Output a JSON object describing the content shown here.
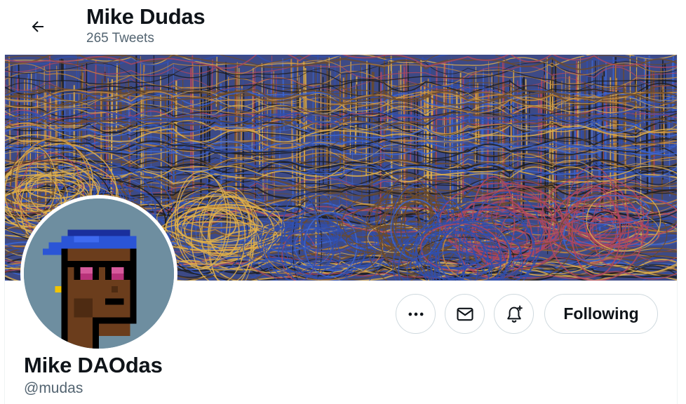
{
  "header": {
    "title": "Mike Dudas",
    "tweet_count": "265 Tweets",
    "back_icon": "arrow-left-icon"
  },
  "profile": {
    "display_name": "Mike DAOdas",
    "handle": "@mudas"
  },
  "actions": {
    "more_icon": "ellipsis-icon",
    "message_icon": "envelope-icon",
    "notify_icon": "bell-plus-icon",
    "follow_label": "Following"
  },
  "colors": {
    "banner_blue": "#2f4fb0",
    "banner_red": "#b0465e",
    "banner_gold": "#e2b24a",
    "banner_brown": "#6b4a2a",
    "avatar_bg": "#6e8ea0",
    "text_secondary": "#536471",
    "border": "#cfd9de"
  }
}
